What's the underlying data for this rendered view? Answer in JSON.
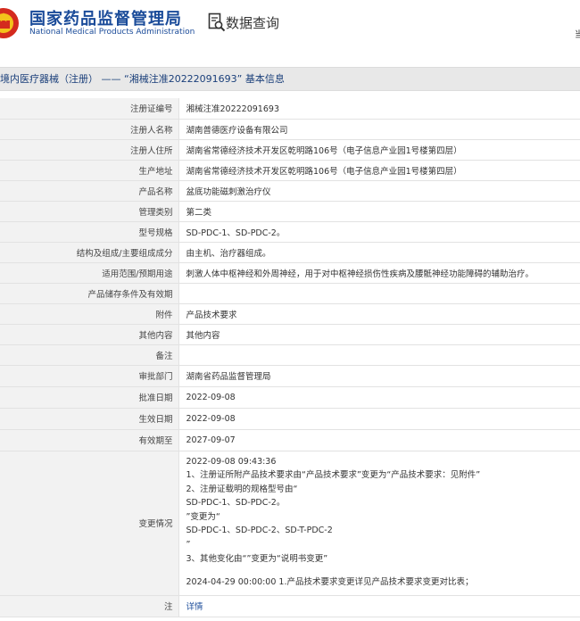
{
  "header": {
    "logo_cn": "国家药品监督管理局",
    "logo_en": "National Medical Products Administration",
    "query_label": "数据查询",
    "corner_char": "当"
  },
  "title": "境内医疗器械（注册） —— “湘械注准20222091693” 基本信息",
  "rows": [
    {
      "label": "注册证编号",
      "value": "湘械注准20222091693"
    },
    {
      "label": "注册人名称",
      "value": "湖南普德医疗设备有限公司"
    },
    {
      "label": "注册人住所",
      "value": "湖南省常德经济技术开发区乾明路106号（电子信息产业园1号楼第四层）"
    },
    {
      "label": "生产地址",
      "value": "湖南省常德经济技术开发区乾明路106号（电子信息产业园1号楼第四层）"
    },
    {
      "label": "产品名称",
      "value": "盆底功能磁刺激治疗仪"
    },
    {
      "label": "管理类别",
      "value": "第二类"
    },
    {
      "label": "型号规格",
      "value": "SD-PDC-1、SD-PDC-2。"
    },
    {
      "label": "结构及组成/主要组成成分",
      "value": "由主机、治疗器组成。"
    },
    {
      "label": "适用范围/预期用途",
      "value": "刺激人体中枢神经和外周神经，用于对中枢神经损伤性疾病及腰骶神经功能障碍的辅助治疗。"
    },
    {
      "label": "产品储存条件及有效期",
      "value": ""
    },
    {
      "label": "附件",
      "value": "产品技术要求"
    },
    {
      "label": "其他内容",
      "value": "其他内容"
    },
    {
      "label": "备注",
      "value": ""
    },
    {
      "label": "审批部门",
      "value": "湖南省药品监督管理局"
    },
    {
      "label": "批准日期",
      "value": "2022-09-08"
    },
    {
      "label": "生效日期",
      "value": "2022-09-08"
    },
    {
      "label": "有效期至",
      "value": "2027-09-07"
    }
  ],
  "changes": {
    "label": "变更情况",
    "lines_1": [
      "2022-09-08 09:43:36",
      "1、注册证所附产品技术要求由“产品技术要求”变更为“产品技术要求：见附件”",
      "2、注册证载明的规格型号由“",
      "SD-PDC-1、SD-PDC-2。",
      "”变更为“",
      "SD-PDC-1、SD-PDC-2、SD-T-PDC-2",
      "”",
      "3、其他变化由“”变更为“说明书变更”"
    ],
    "lines_2": [
      "2024-04-29 00:00:00 1.产品技术要求变更详见产品技术要求变更对比表；"
    ]
  },
  "footer_row": {
    "label": "注",
    "value": "详情"
  },
  "colors": {
    "brand_blue": "#1a4b99",
    "label_bg": "#f2f2f2",
    "title_bg": "#e8e8e8"
  }
}
